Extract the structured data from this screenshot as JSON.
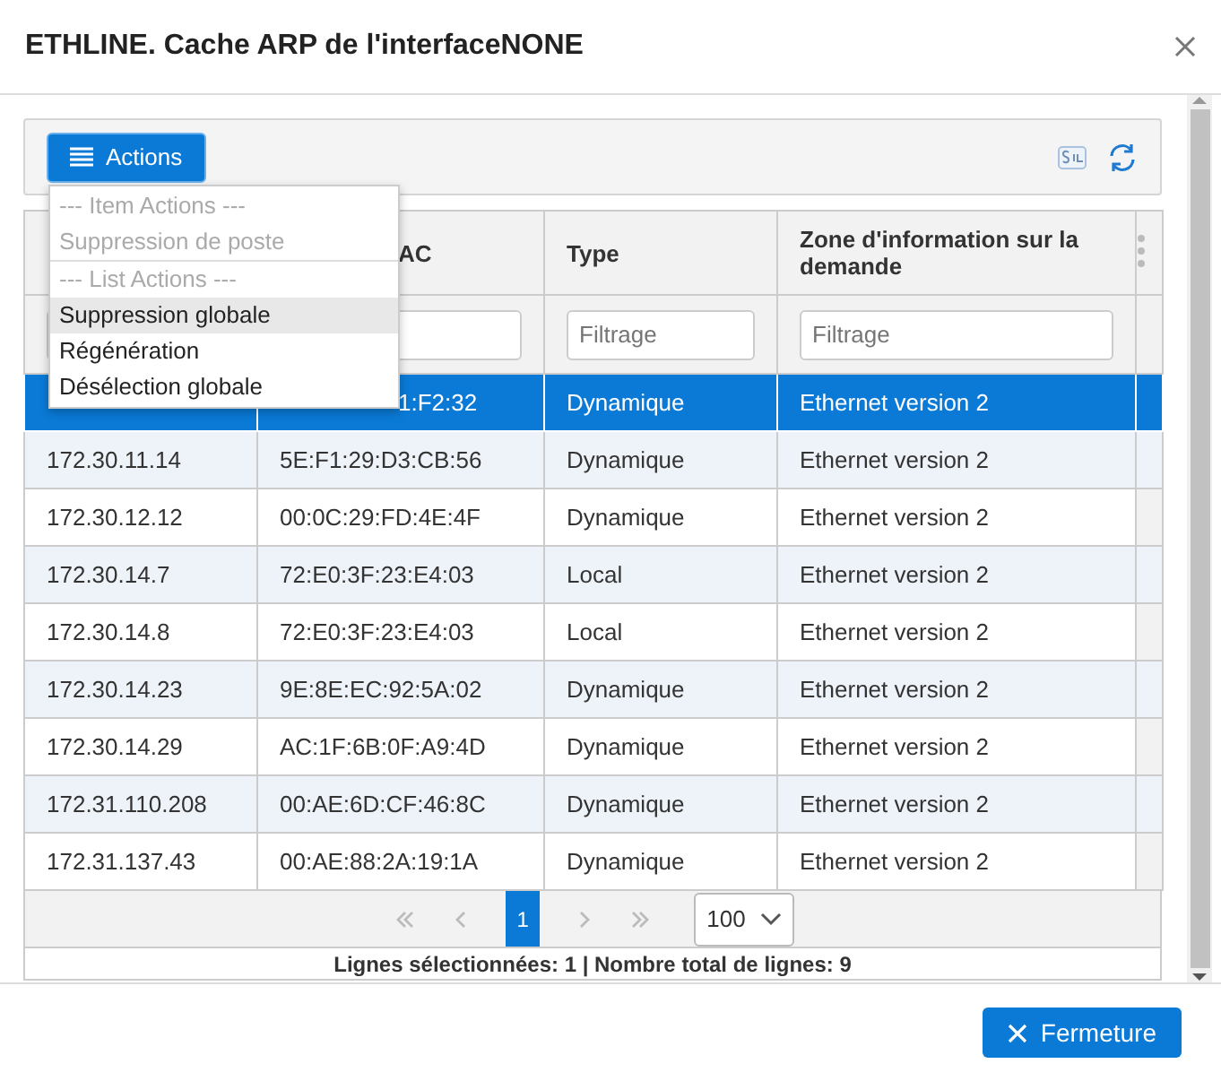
{
  "dialog": {
    "title": "ETHLINE. Cache ARP de l'interfaceNONE"
  },
  "toolbar": {
    "actions_button": "Actions"
  },
  "actions_menu": [
    {
      "kind": "header",
      "label": "--- Item Actions ---"
    },
    {
      "kind": "item",
      "label": "Suppression de poste",
      "disabled": true,
      "highlighted": false
    },
    {
      "kind": "header",
      "label": "--- List Actions ---"
    },
    {
      "kind": "item",
      "label": "Suppression globale",
      "disabled": false,
      "highlighted": true
    },
    {
      "kind": "item",
      "label": "Régénération",
      "disabled": false,
      "highlighted": false
    },
    {
      "kind": "item",
      "label": "Désélection globale",
      "disabled": false,
      "highlighted": false
    }
  ],
  "table": {
    "columns": [
      {},
      {
        "label": "AC"
      },
      {
        "label": "Type",
        "placeholder": "Filtrage"
      },
      {
        "label": "Zone d'information sur la demande",
        "placeholder": "Filtrage"
      }
    ],
    "rows": [
      {
        "column_2": "1:F2:32",
        "column_3": "Dynamique",
        "column_4": "Ethernet version 2",
        "selected": true
      },
      {
        "column_1": "172.30.11.14",
        "column_2": "5E:F1:29:D3:CB:56",
        "column_3": "Dynamique",
        "column_4": "Ethernet version 2",
        "selected": false
      },
      {
        "column_1": "172.30.12.12",
        "column_2": "00:0C:29:FD:4E:4F",
        "column_3": "Dynamique",
        "column_4": "Ethernet version 2",
        "selected": false
      },
      {
        "column_1": "172.30.14.7",
        "column_2": "72:E0:3F:23:E4:03",
        "column_3": "Local",
        "column_4": "Ethernet version 2",
        "selected": false
      },
      {
        "column_1": "172.30.14.8",
        "column_2": "72:E0:3F:23:E4:03",
        "column_3": "Local",
        "column_4": "Ethernet version 2",
        "selected": false
      },
      {
        "column_1": "172.30.14.23",
        "column_2": "9E:8E:EC:92:5A:02",
        "column_3": "Dynamique",
        "column_4": "Ethernet version 2",
        "selected": false
      },
      {
        "column_1": "172.30.14.29",
        "column_2": "AC:1F:6B:0F:A9:4D",
        "column_3": "Dynamique",
        "column_4": "Ethernet version 2",
        "selected": false
      },
      {
        "column_1": "172.31.110.208",
        "column_2": "00:AE:6D:CF:46:8C",
        "column_3": "Dynamique",
        "column_4": "Ethernet version 2",
        "selected": false
      },
      {
        "column_1": "172.31.137.43",
        "column_2": "00:AE:88:2A:19:1A",
        "column_3": "Dynamique",
        "column_4": "Ethernet version 2",
        "selected": false
      }
    ]
  },
  "pager": {
    "pages": [
      {
        "label": "1",
        "selected": true
      }
    ],
    "page_size": "100"
  },
  "status": "Lignes sélectionnées: 1 | Nombre total de lignes: 9",
  "footer": {
    "close_button": "Fermeture"
  }
}
